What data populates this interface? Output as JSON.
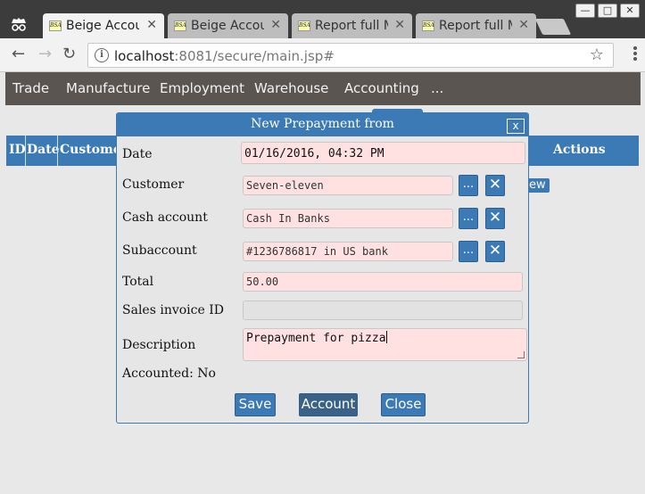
{
  "browser": {
    "tabs": [
      {
        "favicon": "BSA",
        "label": "Beige Accou",
        "close": "✕"
      },
      {
        "favicon": "BSA",
        "label": "Beige Accou",
        "close": "✕"
      },
      {
        "favicon": "BSA",
        "label": "Report full M",
        "close": "✕"
      },
      {
        "favicon": "BSA",
        "label": "Report full M",
        "close": "✕"
      }
    ],
    "url_host": "localhost",
    "url_rest": ":8081/secure/main.jsp#"
  },
  "appnav": {
    "items": [
      "Trade",
      "Manufacture",
      "Employment",
      "Warehouse",
      "Accounting",
      "..."
    ]
  },
  "background_table": {
    "headers": [
      "ID",
      "Date",
      "Customer",
      "Actions"
    ],
    "row_button": "ew"
  },
  "dialog": {
    "title": "New Prepayment from",
    "close_label": "x",
    "fields": {
      "date": {
        "label": "Date",
        "value": "01/16/2016, 04:32 PM"
      },
      "customer": {
        "label": "Customer",
        "value": "Seven-eleven"
      },
      "cash_account": {
        "label": "Cash account",
        "value": "Cash In Banks"
      },
      "subaccount": {
        "label": "Subaccount",
        "value": "#1236786817 in US bank"
      },
      "total": {
        "label": "Total",
        "value": "50.00"
      },
      "sales_invoice": {
        "label": "Sales invoice ID",
        "value": ""
      },
      "description": {
        "label": "Description",
        "value": "Prepayment for pizza"
      }
    },
    "accounted": "Accounted: No",
    "pick_label": "...",
    "clear_label": "✕",
    "buttons": {
      "save": "Save",
      "account": "Account",
      "close": "Close"
    }
  }
}
